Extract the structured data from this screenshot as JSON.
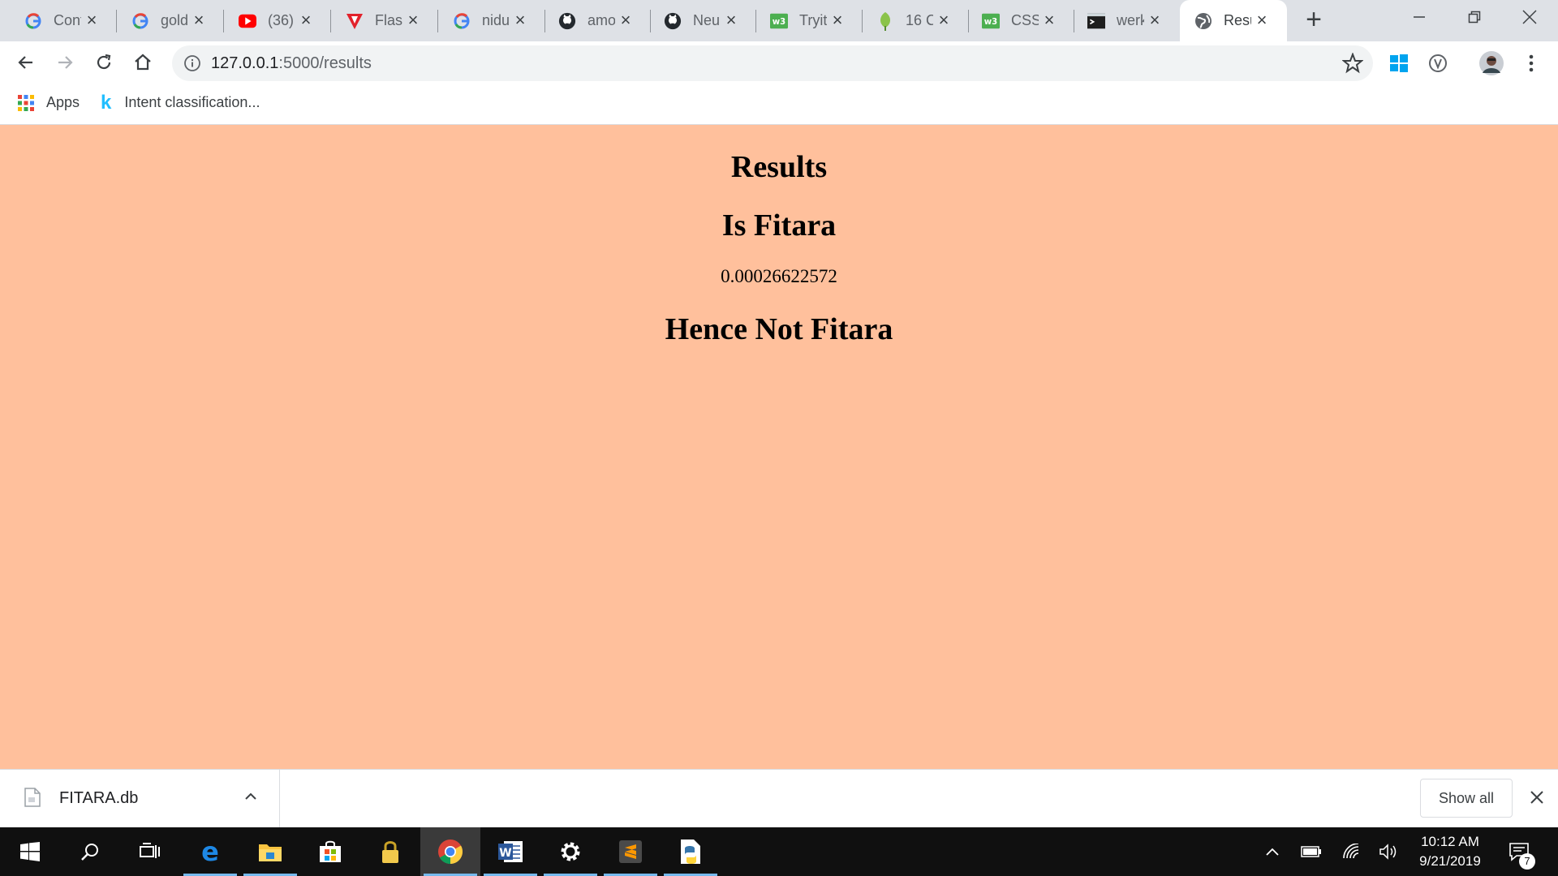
{
  "browser": {
    "tabs": [
      {
        "title": "Conf",
        "icon": "google-icon"
      },
      {
        "title": "gold",
        "icon": "google-icon"
      },
      {
        "title": "(36)",
        "icon": "youtube-icon"
      },
      {
        "title": "Flask",
        "icon": "tensorflow-like-icon"
      },
      {
        "title": "nidu",
        "icon": "google-icon"
      },
      {
        "title": "amo",
        "icon": "github-icon"
      },
      {
        "title": "Neu",
        "icon": "github-icon"
      },
      {
        "title": "Tryit",
        "icon": "w3schools-icon"
      },
      {
        "title": "16 C",
        "icon": "leaf-icon"
      },
      {
        "title": "CSS",
        "icon": "w3schools-icon"
      },
      {
        "title": "werk",
        "icon": "terminal-icon"
      },
      {
        "title": "Resu",
        "icon": "globe-icon",
        "active": true
      }
    ],
    "new_tab_label": "+",
    "address": {
      "host": "127.0.0.1",
      "path": ":5000/results"
    },
    "bookmarks": {
      "apps_label": "Apps",
      "item_label": "Intent classification..."
    }
  },
  "page": {
    "heading": "Results",
    "subheading": "Is Fitara",
    "score": "0.00026622572",
    "verdict": "Hence Not Fitara"
  },
  "downloads": {
    "file_name": "FITARA.db",
    "show_all_label": "Show all"
  },
  "taskbar": {
    "time": "10:12 AM",
    "date": "9/21/2019",
    "notification_count": "7"
  },
  "colors": {
    "page_background": "#ffc09c",
    "tabstrip": "#dee1e6",
    "taskbar": "#101010"
  }
}
